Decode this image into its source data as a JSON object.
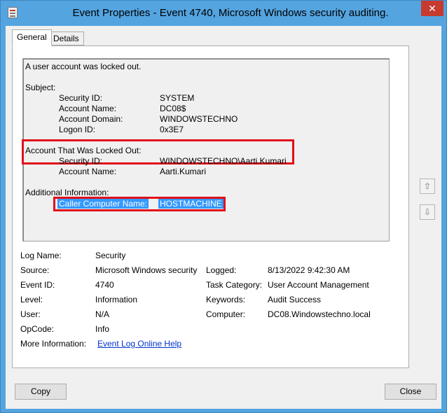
{
  "window": {
    "title": "Event Properties - Event 4740, Microsoft Windows security auditing.",
    "close_glyph": "✕"
  },
  "tabs": [
    {
      "label": "General",
      "active": true
    },
    {
      "label": "Details",
      "active": false
    }
  ],
  "description": {
    "summary": "A user account was locked out.",
    "subject_header": "Subject:",
    "subject": [
      {
        "label": "Security ID:",
        "value": "SYSTEM"
      },
      {
        "label": "Account Name:",
        "value": "DC08$"
      },
      {
        "label": "Account Domain:",
        "value": "WINDOWSTECHNO"
      },
      {
        "label": "Logon ID:",
        "value": "0x3E7"
      }
    ],
    "locked_header": "Account That Was Locked Out:",
    "locked": [
      {
        "label": "Security ID:",
        "value": "WINDOWSTECHNO\\Aarti.Kumari"
      },
      {
        "label": "Account Name:",
        "value": "Aarti.Kumari"
      }
    ],
    "additional_header": "Additional Information:",
    "additional": [
      {
        "label": "Caller Computer Name:",
        "value": "HOSTMACHINE"
      }
    ]
  },
  "fields": {
    "log_name": {
      "label": "Log Name:",
      "value": "Security"
    },
    "source": {
      "label": "Source:",
      "value": "Microsoft Windows security"
    },
    "logged": {
      "label": "Logged:",
      "value": "8/13/2022 9:42:30 AM"
    },
    "event_id": {
      "label": "Event ID:",
      "value": "4740"
    },
    "task_category": {
      "label": "Task Category:",
      "value": "User Account Management"
    },
    "level": {
      "label": "Level:",
      "value": "Information"
    },
    "keywords": {
      "label": "Keywords:",
      "value": "Audit Success"
    },
    "user": {
      "label": "User:",
      "value": "N/A"
    },
    "computer": {
      "label": "Computer:",
      "value": "DC08.Windowstechno.local"
    },
    "opcode": {
      "label": "OpCode:",
      "value": "Info"
    },
    "more_info": {
      "label": "More Information:",
      "value": "Event Log Online Help"
    }
  },
  "buttons": {
    "copy": "Copy",
    "close": "Close",
    "up_glyph": "⇧",
    "down_glyph": "⇩"
  },
  "colors": {
    "titlebar": "#54a4e0",
    "highlight_border": "#e0101a",
    "selection": "#3399ff",
    "link": "#0033cc"
  }
}
